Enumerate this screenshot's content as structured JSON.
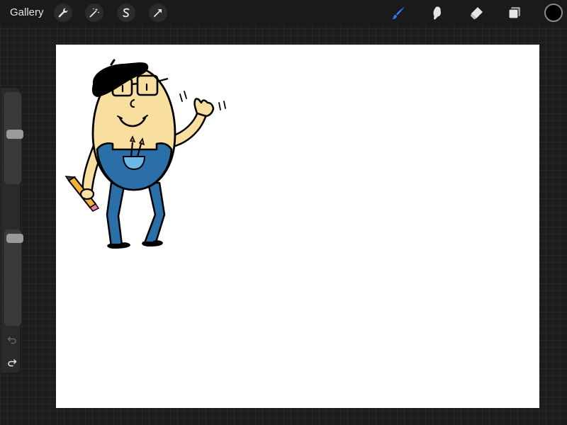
{
  "app": {
    "gallery_label": "Gallery"
  },
  "toolbar": {
    "left_icons": [
      "wrench-icon",
      "magic-wand-icon",
      "selection-s-icon",
      "transform-arrow-icon"
    ],
    "right_icons": [
      "brush-icon",
      "smudge-icon",
      "eraser-icon",
      "layers-icon"
    ],
    "active_tool": "brush",
    "active_color": "#000000",
    "accent_color": "#2f7cf6"
  },
  "sidebar": {
    "brush_size_level": 0.55,
    "brush_opacity_level": 0.95,
    "undo_icon": "undo-icon",
    "redo_icon": "redo-icon"
  },
  "canvas": {
    "background": "#ffffff"
  }
}
